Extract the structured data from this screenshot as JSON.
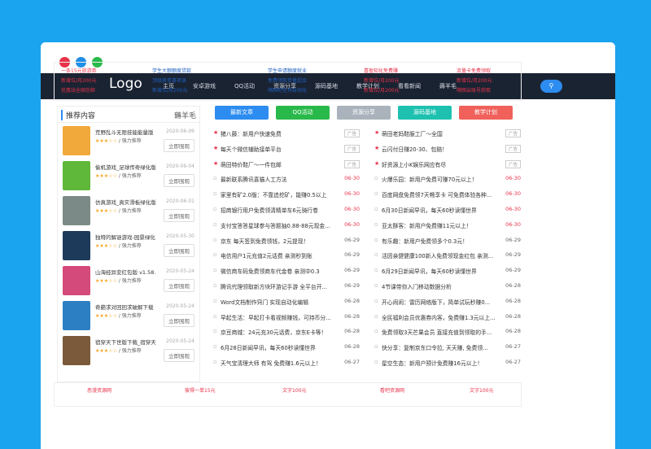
{
  "nav": {
    "logo": "Logo",
    "items": [
      "主页",
      "安卓游戏",
      "QQ活动",
      "资源分享",
      "源码基地",
      "教学计划",
      "看看新闻",
      "薅羊毛"
    ]
  },
  "ads": [
    [
      "一条15元旅游券",
      "新增位/月200元",
      "优惠站全国包邮"
    ],
    [
      "学生大额额度贷款",
      "顶级原单事项录",
      "新增位/月200元"
    ],
    [
      "学生申请额度就业",
      "免费领取单量超会",
      "萌囤吧全场自动化"
    ],
    [
      "喜盈知化免费赚",
      "新增位/月200元",
      "新增位/月200元"
    ],
    [
      "流量卡免费领取",
      "新增位/月200元",
      "萌囤云账号获取"
    ]
  ],
  "side": {
    "title": "推荐内容",
    "right": "薅羊毛",
    "items": [
      {
        "title": "荒野乱斗无限技能能量版",
        "sub": "强力推荐",
        "stars": "★★★☆☆",
        "date": "2020-06-09",
        "btn": "立即围观",
        "color": "#f2a93b"
      },
      {
        "title": "偷机游戏_足球传奇绿化版",
        "sub": "强力推荐",
        "stars": "★★★☆☆",
        "date": "2020-06-04",
        "btn": "立即围观",
        "color": "#5fb83a"
      },
      {
        "title": "仿真游戏_真实滑板绿化版",
        "sub": "强力推荐",
        "stars": "★★★☆☆",
        "date": "2020-06-01",
        "btn": "立即围观",
        "color": "#7b8a86"
      },
      {
        "title": "独特的解谜游戏-园景绿化",
        "sub": "强力推荐",
        "stars": "★★★☆☆",
        "date": "2020-05-30",
        "btn": "立即围观",
        "color": "#1e3a5a"
      },
      {
        "title": "山海经异变红包版 v1.58.",
        "sub": "强力推荐",
        "stars": "★★★☆☆",
        "date": "2020-05-24",
        "btn": "立即围观",
        "color": "#d44a7a"
      },
      {
        "title": "奇葩求对回回求破解下载",
        "sub": "强力推荐",
        "stars": "★★★☆☆",
        "date": "2020-05-24",
        "btn": "立即围观",
        "color": "#2c7fc2"
      },
      {
        "title": "宿穿天下世版下载_宿穿天",
        "sub": "强力推荐",
        "stars": "★★★☆☆",
        "date": "2020-05-24",
        "btn": "立即围观",
        "color": "#7a5a3a"
      }
    ]
  },
  "tabs": [
    {
      "label": "最新文章",
      "color": "#2d8cf0"
    },
    {
      "label": "QQ活动",
      "color": "#29b94a"
    },
    {
      "label": "资源分享",
      "color": "#aab3bc"
    },
    {
      "label": "源码基地",
      "color": "#1ec1b0"
    },
    {
      "label": "教学计划",
      "color": "#f0615b"
    }
  ],
  "left_list": [
    {
      "text": "猪八藤：新用户快速免费",
      "badge": "广告",
      "pin": true
    },
    {
      "text": "每天个微信辅助接单平台",
      "badge": "广告",
      "pin": true
    },
    {
      "text": "萌田特价鞋厂～一件包邮",
      "badge": "广告",
      "pin": true
    },
    {
      "text": "最新联系腾讯喜猫人工方法",
      "date": "06-30",
      "red": true
    },
    {
      "text": "家里有矿2.0版：不靠追挖矿，能赚0.5以上",
      "date": "06-30",
      "red": true
    },
    {
      "text": "招商银行用户免费领清精单车6元骑行卷",
      "date": "06-30",
      "red": true
    },
    {
      "text": "支付宝答答星球参与答题抽0.88-88元现金...",
      "date": "06-30",
      "red": true
    },
    {
      "text": "京东 每天签到免费领钱，2元提现！",
      "date": "06-29"
    },
    {
      "text": "电信用户1元充值2元话费 亲测秒到账",
      "date": "06-29"
    },
    {
      "text": "微信商车码免费领商车代金卷 亲测中0.3",
      "date": "06-29"
    },
    {
      "text": "腾讯代理领取新方块环游记手游 全平台开...",
      "date": "06-29"
    },
    {
      "text": "Word文档制作窍门 实现自动化编辑",
      "date": "06-28"
    },
    {
      "text": "早起生活：早起打卡看视频赚钱，可持币分...",
      "date": "06-28"
    },
    {
      "text": "京豆商城：24元充30元话费，京东E卡等！",
      "date": "06-28"
    },
    {
      "text": "6月28日新闻早讯，每天60秒读懂世界",
      "date": "06-28"
    },
    {
      "text": "天气宝清理大师 有驾 免费赚1.6元以上！",
      "date": "06-27"
    }
  ],
  "right_list": [
    {
      "text": "萌田老妈鞋服工厂～全国",
      "badge": "广告",
      "pin": true
    },
    {
      "text": "云闪付日赚20-30、包赔！",
      "badge": "广告",
      "pin": true
    },
    {
      "text": "好资源上小K娱乐网应有尽",
      "badge": "广告",
      "pin": true
    },
    {
      "text": "火爆乐园：新用户免费可赚70元以上！",
      "date": "06-30",
      "red": true
    },
    {
      "text": "百度网盘免费领7天畅享卡 可免费体验各种...",
      "date": "06-30",
      "red": true
    },
    {
      "text": "6月30日新闻早讯，每天60秒读懂世界",
      "date": "06-30",
      "red": true
    },
    {
      "text": "亚太酥客：新用户免费赚11元以上！",
      "date": "06-30",
      "red": true
    },
    {
      "text": "有乐趣：新用户免费领多个0.3元！",
      "date": "06-29"
    },
    {
      "text": "活因亲健健康100新人免费领现金红包 亲测...",
      "date": "06-29"
    },
    {
      "text": "6月29日新闻早讯，每天60秒读懂世界",
      "date": "06-29"
    },
    {
      "text": "4节课带你入门移动数据分析",
      "date": "06-28"
    },
    {
      "text": "开心闹闹：雷历网络版下，简单试玩秒赚0...",
      "date": "06-28"
    },
    {
      "text": "全民福利会员优惠券内客，免费赚1.3元以上...",
      "date": "06-28"
    },
    {
      "text": "免费领取3天芒果会员 直接充值到领取的手...",
      "date": "06-28"
    },
    {
      "text": "快分享：复制京东口令拉, 天天赚, 免费领...",
      "date": "06-27"
    },
    {
      "text": "星空生态：新用户预计免费赚16元以上！",
      "date": "06-27"
    }
  ],
  "bottom": [
    "恶漫资源网",
    "彼得一单15元",
    "文字100元",
    "看吧资源网",
    "文字100元"
  ]
}
